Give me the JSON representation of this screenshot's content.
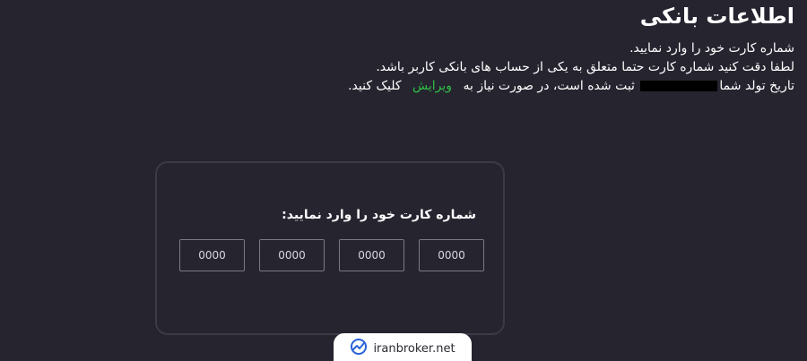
{
  "header": {
    "title": "اطلاعات بانکی"
  },
  "info": {
    "line1": "شماره کارت خود را وارد نمایید.",
    "line2": "لطفا دقت کنید شماره کارت حتما متعلق به یکی از حساب های بانکی کاربر باشد.",
    "line3_prefix": "تاریخ تولد شما",
    "line3_middle": "ثبت شده است، در صورت نیاز به",
    "edit_link": "ویرایش",
    "line3_suffix": "کلیک کنید."
  },
  "card_form": {
    "label": "شماره کارت خود را وارد نمایید:",
    "fields": [
      {
        "placeholder": "0000"
      },
      {
        "placeholder": "0000"
      },
      {
        "placeholder": "0000"
      },
      {
        "placeholder": "0000"
      }
    ]
  },
  "watermark": {
    "text": "iranbroker.net",
    "logo_icon": "chart-trend-icon",
    "accent": "#2b63d9"
  },
  "colors": {
    "background": "#25242f",
    "link": "#2fbf46",
    "box_border": "#3b3b48"
  }
}
